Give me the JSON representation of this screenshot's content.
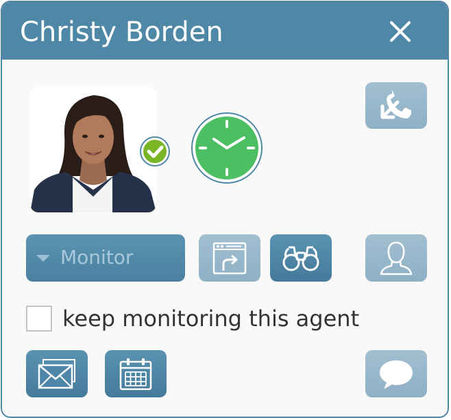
{
  "window": {
    "title": "Christy Borden",
    "close_icon": "close-icon"
  },
  "agent": {
    "status": "available",
    "status_color": "#7ab526",
    "timer_color": "#4dbf63"
  },
  "controls": {
    "monitor_select": {
      "selected": "Monitor"
    },
    "keep_monitoring": {
      "label": "keep monitoring this agent",
      "checked": false
    }
  },
  "icons": {
    "call_transfer": "phone-transfer-icon",
    "screen_share": "screen-share-icon",
    "binoculars": "binoculars-icon",
    "user_profile": "user-icon",
    "email": "envelope-icon",
    "calendar": "calendar-icon",
    "chat": "chat-icon"
  },
  "colors": {
    "accent": "#4e88a6",
    "button_dark": "#4d86a6",
    "button_light": "#98b8cb",
    "background": "#f9f9f9"
  }
}
